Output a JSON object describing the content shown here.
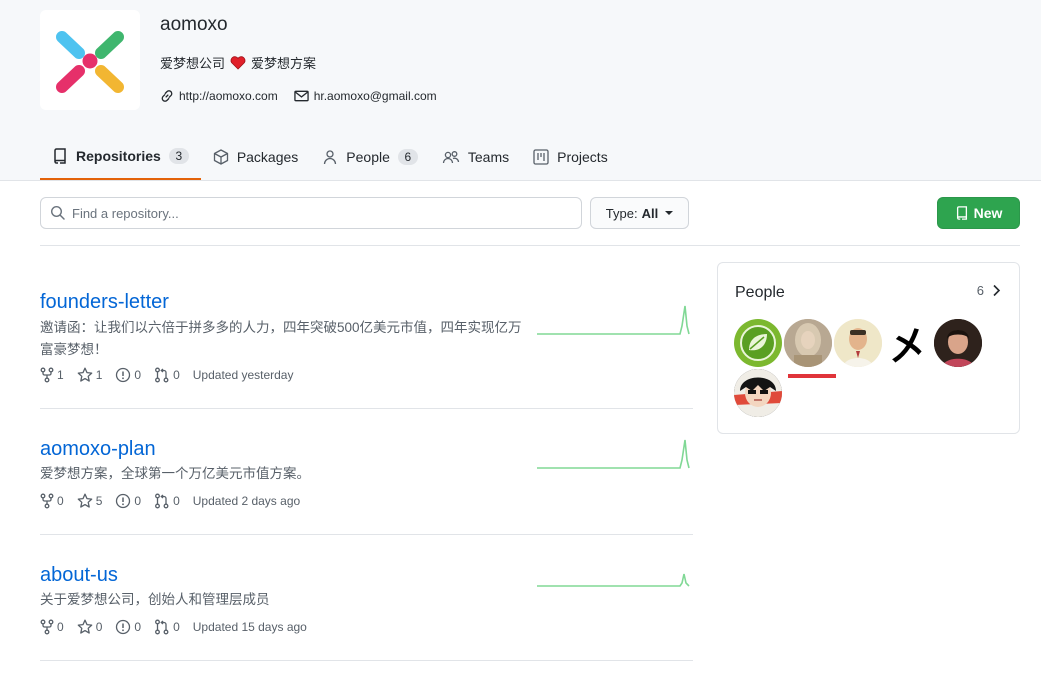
{
  "org": {
    "name": "aomoxo",
    "description_part1": "爱梦想公司",
    "description_part2": "爱梦想方案",
    "website": "http://aomoxo.com",
    "email": "hr.aomoxo@gmail.com"
  },
  "tabs": [
    {
      "label": "Repositories",
      "count": "3",
      "icon": "repo-icon",
      "active": true
    },
    {
      "label": "Packages",
      "icon": "package-icon"
    },
    {
      "label": "People",
      "count": "6",
      "icon": "person-icon"
    },
    {
      "label": "Teams",
      "icon": "people-icon"
    },
    {
      "label": "Projects",
      "icon": "project-icon"
    }
  ],
  "search": {
    "placeholder": "Find a repository..."
  },
  "type_filter": {
    "label": "Type:",
    "value": "All"
  },
  "new_button": {
    "label": "New"
  },
  "repos": [
    {
      "name": "founders-letter",
      "description": "邀请函：让我们以六倍于拼多多的人力，四年突破500亿美元市值，四年实现亿万富豪梦想！",
      "forks": "1",
      "stars": "1",
      "issues": "0",
      "pulls": "0",
      "updated": "Updated yesterday"
    },
    {
      "name": "aomoxo-plan",
      "description": "爱梦想方案，全球第一个万亿美元市值方案。",
      "forks": "0",
      "stars": "5",
      "issues": "0",
      "pulls": "0",
      "updated": "Updated 2 days ago"
    },
    {
      "name": "about-us",
      "description": "关于爱梦想公司，创始人和管理层成员",
      "forks": "0",
      "stars": "0",
      "issues": "0",
      "pulls": "0",
      "updated": "Updated 15 days ago"
    }
  ],
  "people": {
    "title": "People",
    "count": "6",
    "avatar_glyph": "㐅"
  },
  "colors": {
    "link": "#0366d6",
    "primary_button": "#2ea44f",
    "active_tab_underline": "#e36209",
    "sparkline": "#2cbe4e"
  }
}
